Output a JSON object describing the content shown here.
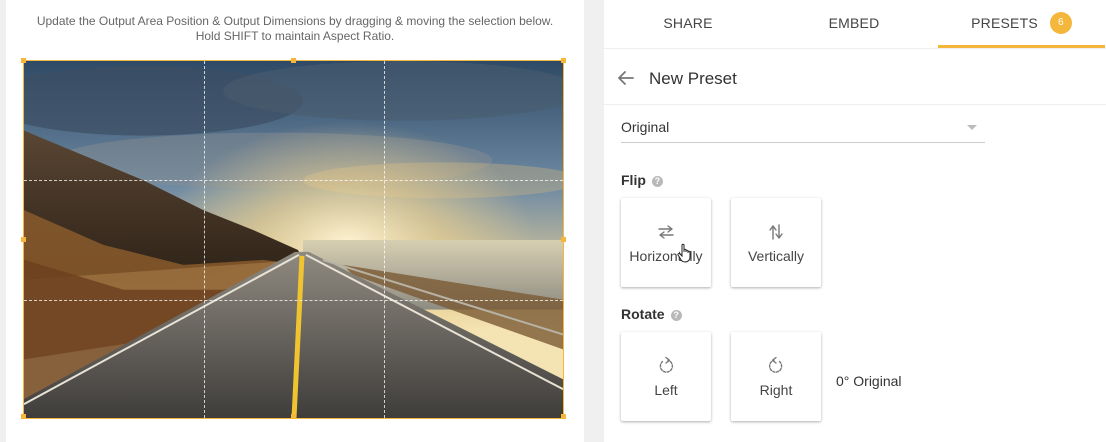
{
  "editor": {
    "instruction_line1": "Update the Output Area Position & Output Dimensions by dragging & moving the selection below.",
    "instruction_line2": "Hold SHIFT to maintain Aspect Ratio."
  },
  "tabs": [
    {
      "label": "SHARE"
    },
    {
      "label": "EMBED"
    },
    {
      "label": "PRESETS",
      "badge": "6",
      "active": true
    }
  ],
  "preset": {
    "title": "New Preset",
    "select_value": "Original",
    "flip_label": "Flip",
    "flip_buttons": [
      {
        "label": "Horizontally",
        "icon": "swap-horizontal-icon"
      },
      {
        "label": "Vertically",
        "icon": "swap-vertical-icon"
      }
    ],
    "rotate_label": "Rotate",
    "rotate_buttons": [
      {
        "label": "Left",
        "icon": "rotate-left-icon"
      },
      {
        "label": "Right",
        "icon": "rotate-right-icon"
      }
    ],
    "rotation_status": "0° Original",
    "help_glyph": "?"
  },
  "colors": {
    "accent": "#f5b73b"
  }
}
